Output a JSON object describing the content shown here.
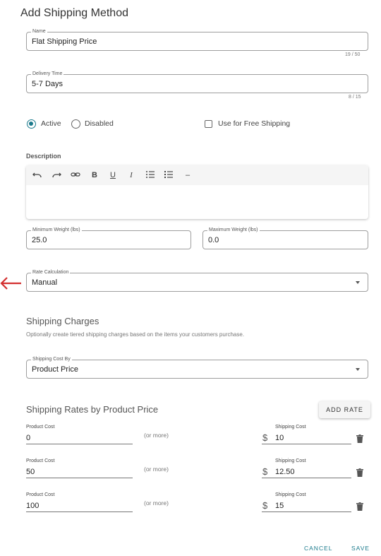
{
  "dialog": {
    "title": "Add Shipping Method"
  },
  "name_field": {
    "label": "Name",
    "value": "Flat Shipping Price",
    "counter": "19 / 50"
  },
  "delivery_field": {
    "label": "Delivery Time",
    "value": "5-7 Days",
    "counter": "8 / 15"
  },
  "status": {
    "options": [
      "Active",
      "Disabled"
    ],
    "selected": "Active",
    "free_shipping_label": "Use for Free Shipping",
    "free_shipping_checked": false
  },
  "description": {
    "label": "Description",
    "toolbar_icons": [
      "undo-icon",
      "redo-icon",
      "link-icon",
      "bold-icon",
      "underline-icon",
      "italic-icon",
      "bullet-list-icon",
      "numbered-list-icon",
      "horizontal-rule-icon"
    ],
    "toolbar_glyphs": {
      "bold": "B",
      "underline": "U",
      "italic": "I",
      "rule": "–"
    }
  },
  "min_weight": {
    "label": "Minimum Weight (lbs)",
    "value": "25.0"
  },
  "max_weight": {
    "label": "Maximum Weight (lbs)",
    "value": "0.0"
  },
  "rate_calc": {
    "label": "Rate Calculation",
    "value": "Manual"
  },
  "annotation": {
    "arrow_color": "#d32f2f"
  },
  "charges": {
    "heading": "Shipping Charges",
    "subtitle": "Optionally create tiered shipping charges based on the items your customers purchase.",
    "cost_by": {
      "label": "Shipping Cost By",
      "value": "Product Price"
    }
  },
  "rates": {
    "heading": "Shipping Rates by Product Price",
    "add_label": "ADD RATE",
    "rows": [
      {
        "product_label": "Product Cost",
        "product_value": "0",
        "or_more": "(or more)",
        "ship_label": "Shipping Cost",
        "currency": "$",
        "ship_value": "10"
      },
      {
        "product_label": "Product Cost",
        "product_value": "50",
        "or_more": "(or more)",
        "ship_label": "Shipping Cost",
        "currency": "$",
        "ship_value": "12.50"
      },
      {
        "product_label": "Product Cost",
        "product_value": "100",
        "or_more": "(or more)",
        "ship_label": "Shipping Cost",
        "currency": "$",
        "ship_value": "15"
      }
    ]
  },
  "actions": {
    "cancel_label": "CANCEL",
    "save_label": "SAVE"
  },
  "colors": {
    "accent": "#1b7a8c",
    "arrow": "#d32f2f"
  }
}
